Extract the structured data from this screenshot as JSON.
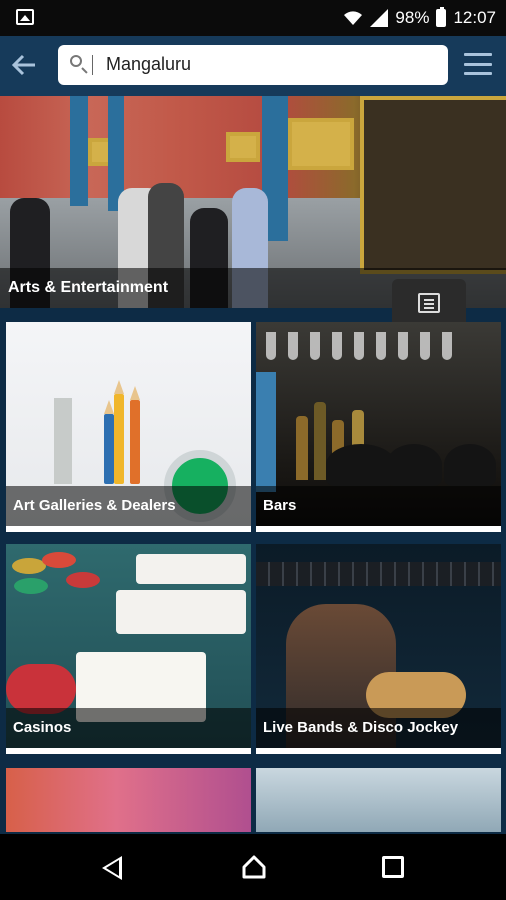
{
  "status_bar": {
    "battery": "98%",
    "time": "12:07"
  },
  "search": {
    "value": "Mangaluru"
  },
  "hero": {
    "label": "Arts & Entertainment"
  },
  "categories": [
    {
      "label": "Art Galleries & Dealers"
    },
    {
      "label": "Bars"
    },
    {
      "label": "Casinos"
    },
    {
      "label": "Live Bands & Disco Jockey"
    }
  ],
  "colors": {
    "app_bar": "#163a5a",
    "page_bg": "#0d2b45",
    "menu_icon": "#a9c3dc"
  },
  "icons": [
    "image-icon",
    "wifi-icon",
    "signal-icon",
    "battery-icon",
    "back-arrow-icon",
    "search-icon",
    "menu-icon",
    "list-view-icon",
    "nav-back-icon",
    "nav-home-icon",
    "nav-recents-icon"
  ]
}
